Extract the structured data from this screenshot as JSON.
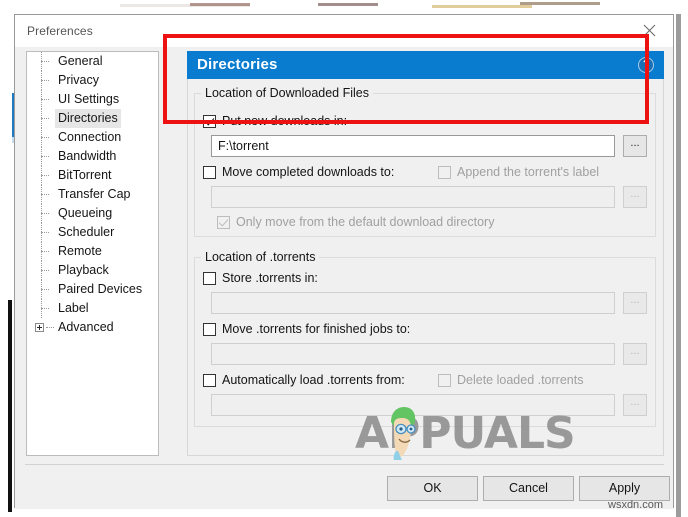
{
  "window": {
    "title": "Preferences",
    "close_icon": "close-icon"
  },
  "sidebar": {
    "items": [
      {
        "label": "General",
        "selected": false,
        "expandable": false
      },
      {
        "label": "Privacy",
        "selected": false,
        "expandable": false
      },
      {
        "label": "UI Settings",
        "selected": false,
        "expandable": false
      },
      {
        "label": "Directories",
        "selected": true,
        "expandable": false
      },
      {
        "label": "Connection",
        "selected": false,
        "expandable": false
      },
      {
        "label": "Bandwidth",
        "selected": false,
        "expandable": false
      },
      {
        "label": "BitTorrent",
        "selected": false,
        "expandable": false
      },
      {
        "label": "Transfer Cap",
        "selected": false,
        "expandable": false
      },
      {
        "label": "Queueing",
        "selected": false,
        "expandable": false
      },
      {
        "label": "Scheduler",
        "selected": false,
        "expandable": false
      },
      {
        "label": "Remote",
        "selected": false,
        "expandable": false
      },
      {
        "label": "Playback",
        "selected": false,
        "expandable": false
      },
      {
        "label": "Paired Devices",
        "selected": false,
        "expandable": false
      },
      {
        "label": "Label",
        "selected": false,
        "expandable": false
      },
      {
        "label": "Advanced",
        "selected": false,
        "expandable": true
      }
    ]
  },
  "section": {
    "title": "Directories",
    "help_icon": "?",
    "header_color": "#0a7cd0"
  },
  "groups": {
    "downloaded_files": {
      "title": "Location of Downloaded Files",
      "put_new_downloads": {
        "label": "Put new downloads in:",
        "checked": true,
        "enabled": true,
        "value": "F:\\torrent",
        "browse_label": "..."
      },
      "move_completed": {
        "label": "Move completed downloads to:",
        "checked": false,
        "enabled": true,
        "value": "",
        "browse_label": "..."
      },
      "append_label": {
        "label": "Append the torrent's label",
        "checked": false,
        "enabled": false
      },
      "only_move_default": {
        "label": "Only move from the default download directory",
        "checked": true,
        "enabled": false
      }
    },
    "torrents": {
      "title": "Location of .torrents",
      "store_torrents": {
        "label": "Store .torrents in:",
        "checked": false,
        "enabled": true,
        "value": "",
        "browse_label": "..."
      },
      "move_finished": {
        "label": "Move .torrents for finished jobs to:",
        "checked": false,
        "enabled": true,
        "value": "",
        "browse_label": "..."
      },
      "auto_load": {
        "label": "Automatically load .torrents from:",
        "checked": false,
        "enabled": true,
        "value": "",
        "browse_label": "..."
      },
      "delete_loaded": {
        "label": "Delete loaded .torrents",
        "checked": false,
        "enabled": false
      }
    }
  },
  "footer": {
    "ok": "OK",
    "cancel": "Cancel",
    "apply": "Apply"
  },
  "annotations": {
    "highlight_color": "#ee1111"
  },
  "watermarks": {
    "appuals": "APPUALS",
    "wsxdn": "wsxdn.com"
  }
}
